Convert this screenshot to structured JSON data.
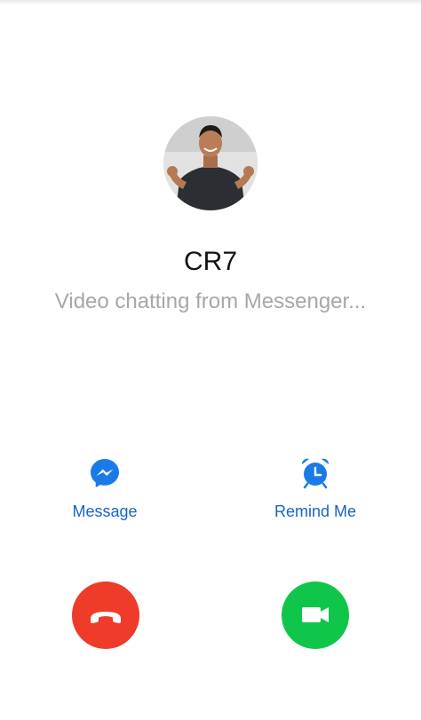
{
  "caller": {
    "name": "CR7",
    "status": "Video chatting from Messenger..."
  },
  "actions": {
    "message_label": "Message",
    "remind_label": "Remind Me"
  },
  "colors": {
    "accent_blue": "#1a63c8",
    "decline_red": "#ee3b2a",
    "accept_green": "#10c64a",
    "status_gray": "#a7a7a7"
  },
  "icons": {
    "message": "messenger-icon",
    "remind": "alarm-clock-icon",
    "decline": "hang-up-phone-icon",
    "accept": "video-camera-icon"
  }
}
